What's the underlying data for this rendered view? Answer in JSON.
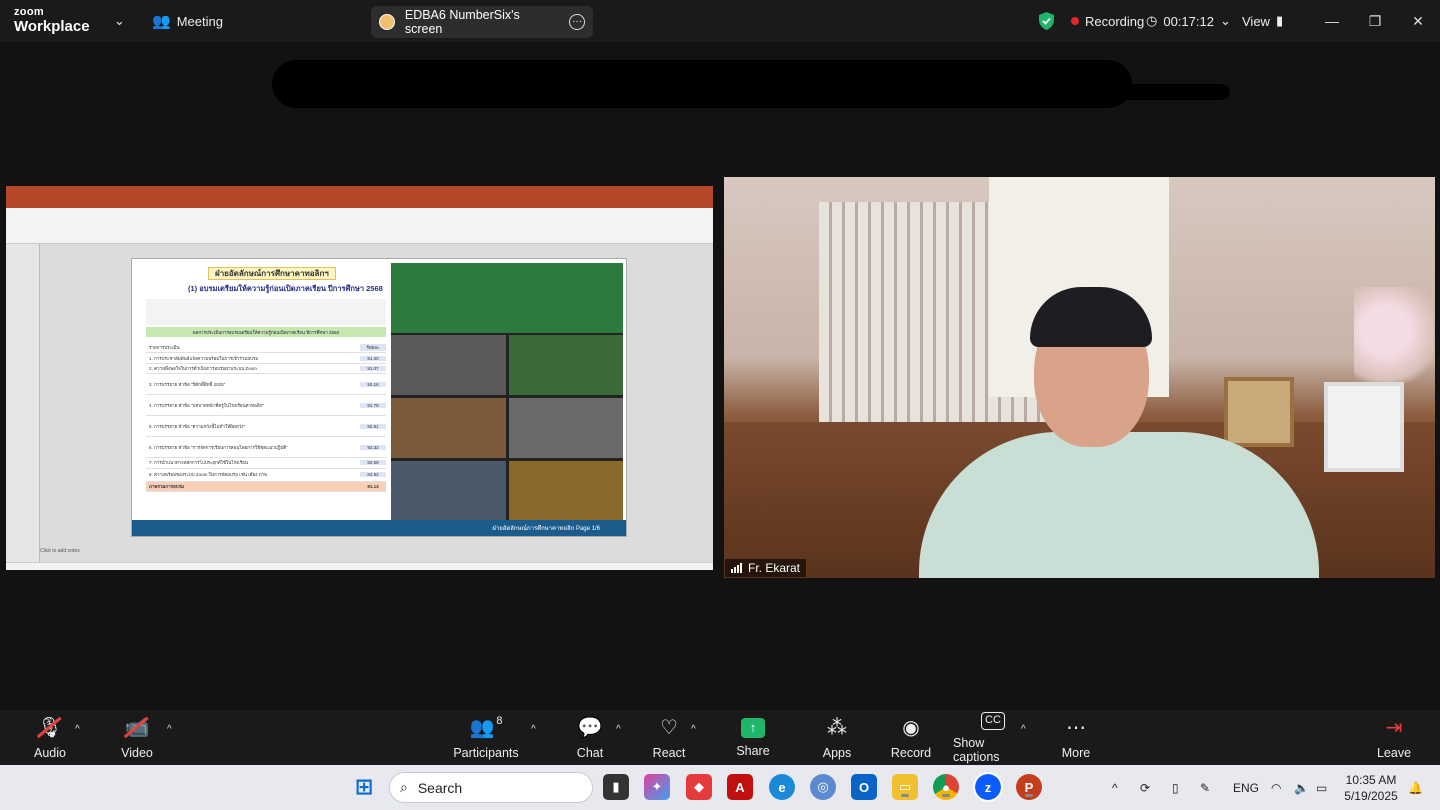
{
  "app": {
    "brand_top": "zoom",
    "brand_bottom": "Workplace"
  },
  "topbar": {
    "meeting_label": "Meeting",
    "share_pill_label": "EDBA6 NumberSix's screen",
    "recording_label": "Recording",
    "timer": "00:17:12",
    "view_label": "View",
    "colors": {
      "recording_dot": "#e02828",
      "shield": "#1fb56a"
    }
  },
  "shared_screen": {
    "slide_title": "ฝ่ายอัตลักษณ์การศึกษาคาทอลิกฯ",
    "slide_subtitle": "(1)  อบรมเตรียมให้ความรู้ก่อนเปิดภาคเรียน ปีการศึกษา 2568",
    "table_header": "ผลการประเมินการอบรมเตรียมให้ความรู้ก่อนเปิดภาคเรียน ปีการศึกษา 2568",
    "col_item": "รายการประเมิน",
    "col_score": "ร้อยละ",
    "rows": [
      {
        "item": "1. การประชาสัมพันธ์แจ้งความพร้อมในการเข้าร่วมอบรม",
        "score": "91.30"
      },
      {
        "item": "2. ความพึงพอใจในการดำเนินการอบรมผ่านระบบ Zoom",
        "score": "91.07"
      },
      {
        "item": "3. การบรรยาย หัวข้อ \"ปีศักดิ์สิทธิ์ 2025\"",
        "score": "92.16"
      },
      {
        "item": "4. การบรรยาย หัวข้อ \"บทบาทหน้าที่ครูในโรงเรียนคาทอลิก\"",
        "score": "91.78"
      },
      {
        "item": "5. การบรรยาย หัวข้อ \"ความหวังนี้ไม่ทำให้ผิดหวัง\"",
        "score": "92.91"
      },
      {
        "item": "6. การบรรยาย หัวข้อ \"การจัดการเรียนการสอนโดยการใช้ชุดแนวปฏิบัติ\"",
        "score": "92.32"
      },
      {
        "item": "7. การนำแนวทางหลักการไปประยุกต์ใช้ในโรงเรียน",
        "score": "92.58"
      },
      {
        "item": "8. ความพร้อมของระบบ Zoom ในการจัดอบรม เช่น เสียง ภาพ",
        "score": "84.92"
      },
      {
        "item": "ภาพรวมการอบรม",
        "score": "91.13"
      }
    ],
    "slide_footer": "ฝ่ายอัตลักษณ์การศึกษาคาทอลิก   Page 1/6",
    "notes_placeholder": "Click to add notes"
  },
  "video": {
    "participant_name": "Fr. Ekarat"
  },
  "toolbar": {
    "audio": "Audio",
    "video": "Video",
    "participants": "Participants",
    "participants_count": "8",
    "chat": "Chat",
    "react": "React",
    "share": "Share",
    "apps": "Apps",
    "record": "Record",
    "captions": "Show captions",
    "more": "More",
    "leave": "Leave"
  },
  "taskbar": {
    "search_placeholder": "Search",
    "lang": "ENG",
    "time": "10:35 AM",
    "date": "5/19/2025"
  }
}
